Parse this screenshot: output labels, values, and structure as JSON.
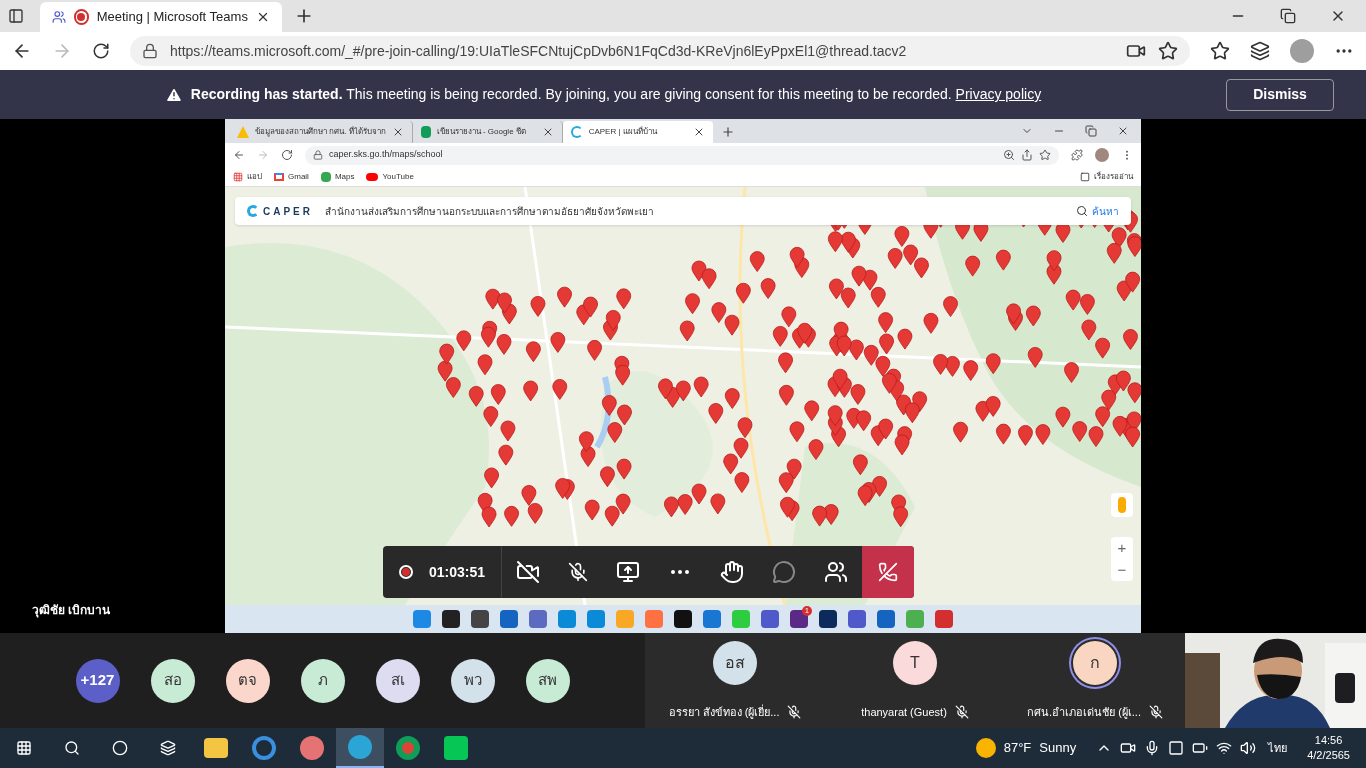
{
  "browser": {
    "tab_title": "Meeting | Microsoft Teams",
    "url": "https://teams.microsoft.com/_#/pre-join-calling/19:UIaTleSFCNtujCpDvb6N1FqCd3d-KReVjn6lEyPpxEl1@thread.tacv2"
  },
  "banner": {
    "text": "**Recording has started.** This meeting is being recorded. By joining, you are giving consent for this meeting to be recorded.",
    "link": "Privacy policy",
    "button": "Dismiss"
  },
  "shared_screen": {
    "tabs": [
      {
        "title": "ข้อมูลของสถานศึกษา กศน. ที่ได้รับจาก",
        "selected": false,
        "kind": "drive"
      },
      {
        "title": "เขียนรายงาน - Google ชีต",
        "selected": false,
        "kind": "sheets"
      },
      {
        "title": "CAPER | แผนที่บ้าน",
        "selected": true,
        "kind": "caper"
      }
    ],
    "url": "caper.sks.go.th/maps/school",
    "bookmarks": [
      {
        "label": "แอป",
        "kind": "apps"
      },
      {
        "label": "Gmail",
        "kind": "gmail"
      },
      {
        "label": "Maps",
        "kind": "maps"
      },
      {
        "label": "YouTube",
        "kind": "youtube"
      }
    ],
    "reading_list": "เรื่องรออ่าน",
    "site": {
      "logo": "CAPER",
      "title": "สำนักงานส่งเสริมการศึกษานอกระบบและการศึกษาตามอัธยาศัยจังหวัดพะเยา",
      "search": "ค้นหา"
    },
    "map_controls": {
      "zoom_in": "+",
      "zoom_out": "−"
    },
    "taskbar_badge": "1",
    "presenter": "วุฒิชัย เบิกบาน"
  },
  "call_controls": {
    "recording": true,
    "timer": "01:03:51"
  },
  "participants": {
    "overflow": "+127",
    "avatars": [
      {
        "initials": "สอ",
        "color": "#c8ebd6"
      },
      {
        "initials": "ตจ",
        "color": "#fbd6ca"
      },
      {
        "initials": "ภ",
        "color": "#c8ebd6"
      },
      {
        "initials": "สเ",
        "color": "#dedcf1"
      },
      {
        "initials": "พว",
        "color": "#d3e2ea"
      },
      {
        "initials": "สพ",
        "color": "#c8ebd6"
      }
    ],
    "tiles": [
      {
        "initials": "อส",
        "name": "อรรยา สังข์ทอง (ผู้เยี่ย...",
        "color": "#d3e2ea",
        "muted": true,
        "speaking": false
      },
      {
        "initials": "T",
        "name": "thanyarat (Guest)",
        "color": "#fadada",
        "muted": true,
        "speaking": false
      },
      {
        "initials": "ก",
        "name": "กศน.อำเภอเด่นชัย (ผู้เ...",
        "color": "#f8d6c2",
        "muted": true,
        "speaking": true
      }
    ]
  },
  "taskbar": {
    "temperature": "87°F",
    "weather": "Sunny",
    "language": "ไทย",
    "time": "14:56",
    "date": "4/2/2565"
  }
}
